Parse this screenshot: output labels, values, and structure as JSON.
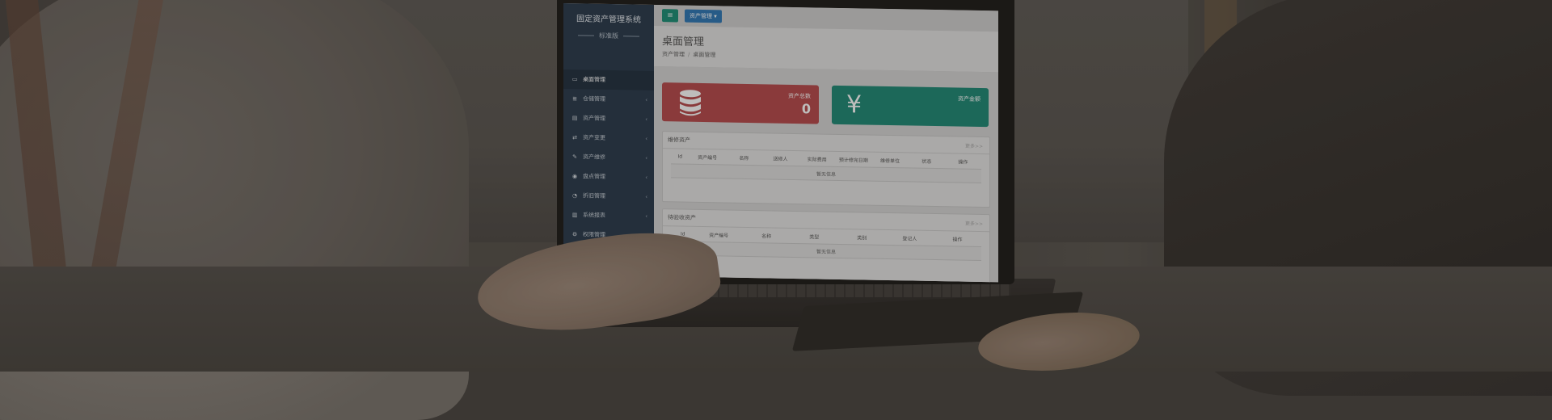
{
  "app": {
    "brand_title": "固定资产管理系统",
    "edition": "标准版"
  },
  "topbar": {
    "toggle_icon": "≡",
    "module_label": "资产管理 ▾"
  },
  "sidebar": {
    "items": [
      {
        "label": "桌面管理",
        "icon": "monitor-icon",
        "glyph": "▭",
        "active": true,
        "arrow": ""
      },
      {
        "label": "仓储管理",
        "icon": "database-icon",
        "glyph": "≣",
        "active": false,
        "arrow": "‹"
      },
      {
        "label": "资产管理",
        "icon": "file-icon",
        "glyph": "▤",
        "active": false,
        "arrow": "‹"
      },
      {
        "label": "资产变更",
        "icon": "exchange-icon",
        "glyph": "⇄",
        "active": false,
        "arrow": "‹"
      },
      {
        "label": "资产维修",
        "icon": "wrench-icon",
        "glyph": "✎",
        "active": false,
        "arrow": "‹"
      },
      {
        "label": "盘点管理",
        "icon": "eye-icon",
        "glyph": "◉",
        "active": false,
        "arrow": "‹"
      },
      {
        "label": "折旧管理",
        "icon": "pie-icon",
        "glyph": "◔",
        "active": false,
        "arrow": "‹"
      },
      {
        "label": "系统报表",
        "icon": "bar-chart-icon",
        "glyph": "▥",
        "active": false,
        "arrow": "‹"
      },
      {
        "label": "权限管理",
        "icon": "gear-icon",
        "glyph": "⚙",
        "active": false,
        "arrow": "‹"
      }
    ]
  },
  "header": {
    "title": "桌面管理",
    "breadcrumb": [
      "资产管理",
      "桌面管理"
    ]
  },
  "stats": [
    {
      "label": "资产总数",
      "value": "0",
      "icon": "database-icon",
      "color": "#b84a4d"
    },
    {
      "label": "资产金额",
      "value": "",
      "icon": "yen-icon",
      "glyph": "¥",
      "color": "#1f8a77"
    }
  ],
  "panels": [
    {
      "title": "维修资产",
      "more": "更多>>",
      "columns": [
        "Id",
        "资产编号",
        "名称",
        "送修人",
        "实际费用",
        "预计修完日期",
        "维修单位",
        "状态",
        "操作"
      ],
      "empty_text": "暂无信息"
    },
    {
      "title": "待验收资产",
      "more": "更多>>",
      "columns": [
        "Id",
        "资产编号",
        "名称",
        "类型",
        "类别",
        "登记人",
        "操作"
      ],
      "empty_text": "暂无信息"
    }
  ],
  "colors": {
    "sidebar_bg": "#2a3b4d",
    "stat_red": "#b84a4d",
    "stat_teal": "#1f8a77",
    "toggle_green": "#1c8f78",
    "module_blue": "#2f78b6"
  }
}
